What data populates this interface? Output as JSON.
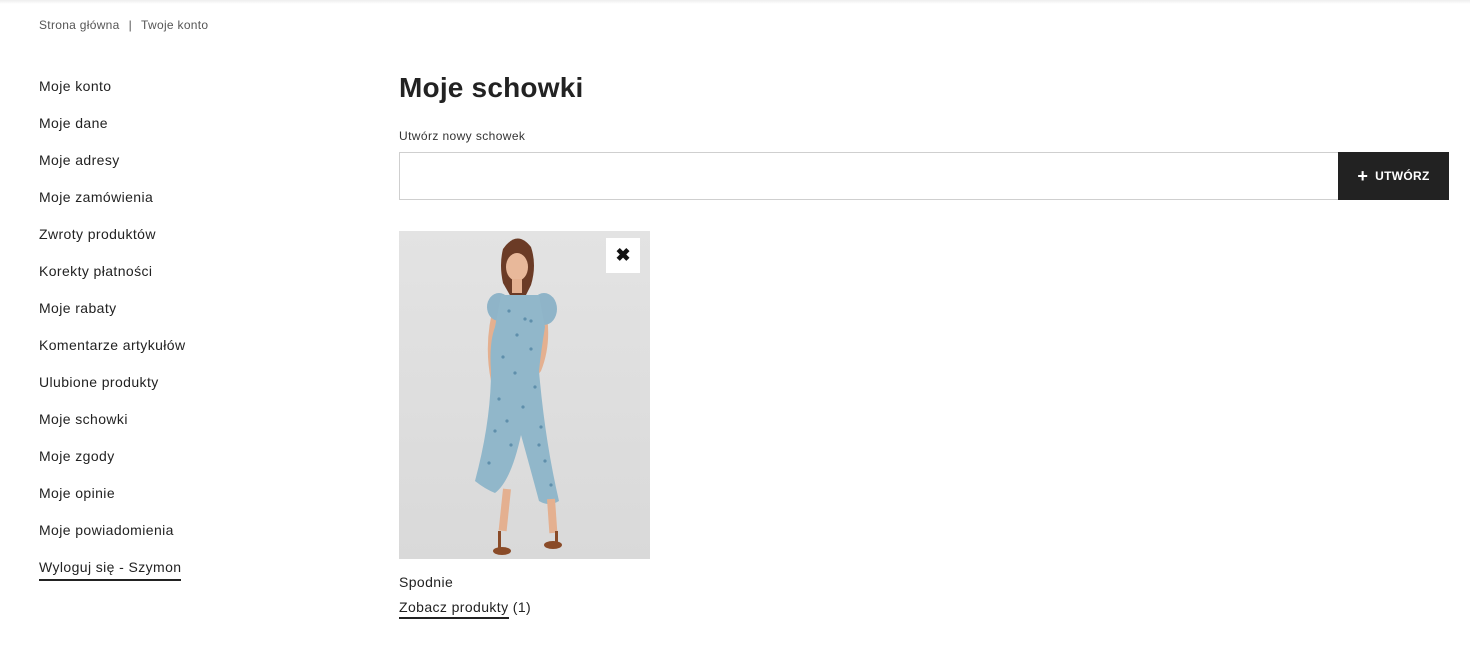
{
  "breadcrumb": {
    "home": "Strona główna",
    "separator": "|",
    "current": "Twoje konto"
  },
  "sidebar": {
    "items": [
      {
        "label": "Moje konto"
      },
      {
        "label": "Moje dane"
      },
      {
        "label": "Moje adresy"
      },
      {
        "label": "Moje zamówienia"
      },
      {
        "label": "Zwroty produktów"
      },
      {
        "label": "Korekty płatności"
      },
      {
        "label": "Moje rabaty"
      },
      {
        "label": "Komentarze artykułów"
      },
      {
        "label": "Ulubione produkty"
      },
      {
        "label": "Moje schowki"
      },
      {
        "label": "Moje zgody"
      },
      {
        "label": "Moje opinie"
      },
      {
        "label": "Moje powiadomienia"
      },
      {
        "label": "Wyloguj się - Szymon"
      }
    ]
  },
  "main": {
    "title": "Moje schowki",
    "new_label": "Utwórz nowy schowek",
    "input_value": "",
    "create_button": {
      "icon": "plus-icon",
      "label": "UTWÓRZ"
    },
    "cards": [
      {
        "name": "Spodnie",
        "link_label": "Zobacz produkty",
        "count": "(1)",
        "image": "woman-in-blue-floral-dress",
        "remove_icon": "close-icon"
      }
    ]
  },
  "colors": {
    "text": "#222222",
    "button_bg": "#222222",
    "button_text": "#ffffff",
    "border": "#cfcfcf",
    "image_bg": "#dedede"
  }
}
